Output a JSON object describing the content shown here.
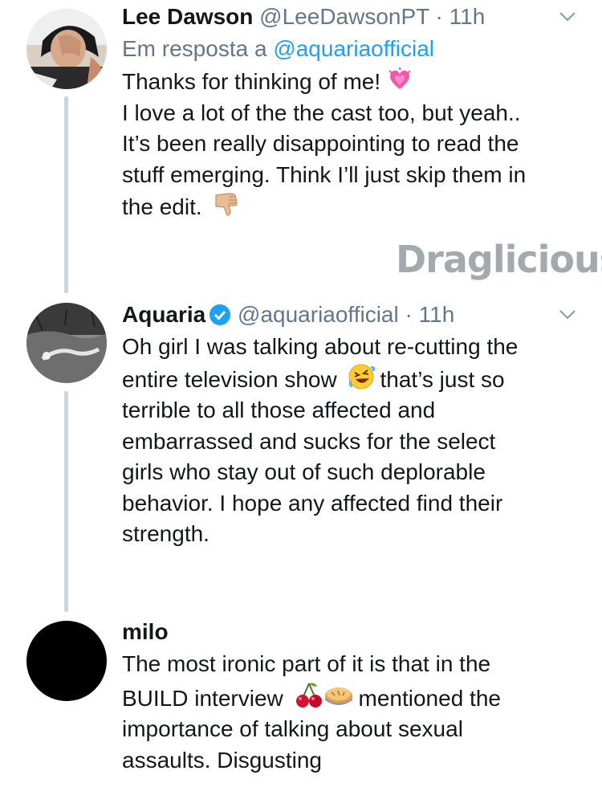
{
  "tweets": [
    {
      "name": "Lee Dawson",
      "handle": "@LeeDawsonPT",
      "dot": "·",
      "time": "11h",
      "reply_prefix": "Em resposta a",
      "reply_mention": "@aquariaofficial",
      "lines": [
        "Thanks for thinking of me!",
        "I love a lot of the the cast too, but yeah..",
        "It’s been really disappointing to read the",
        "stuff emerging. Think I’ll just skip them in",
        "the edit."
      ],
      "emojis": [
        "heart-emoji",
        "thumbs-down-emoji"
      ]
    },
    {
      "name": "Aquaria",
      "verified": true,
      "handle": "@aquariaofficial",
      "dot": "·",
      "time": "11h",
      "lines": [
        "Oh girl I was talking about re-cutting the",
        "entire television show",
        "that’s just so",
        "terrible to all those affected and",
        "embarrassed and sucks for the select",
        "girls who stay out of such deplorable",
        "behavior. I hope any affected find their",
        "strength."
      ],
      "emojis": [
        "rofl-emoji"
      ]
    },
    {
      "name": "milo",
      "lines": [
        "The most ironic part of it is that in the",
        "BUILD interview",
        "mentioned the",
        "importance of talking about sexual",
        "assaults. Disgusting"
      ],
      "emojis": [
        "cherries-emoji",
        "pie-emoji"
      ]
    }
  ],
  "watermark": "Draglicious",
  "colors": {
    "link": "#1da1f2",
    "muted": "#657786",
    "thread_line": "#ccd6dd",
    "verified": "#1da1f2"
  }
}
